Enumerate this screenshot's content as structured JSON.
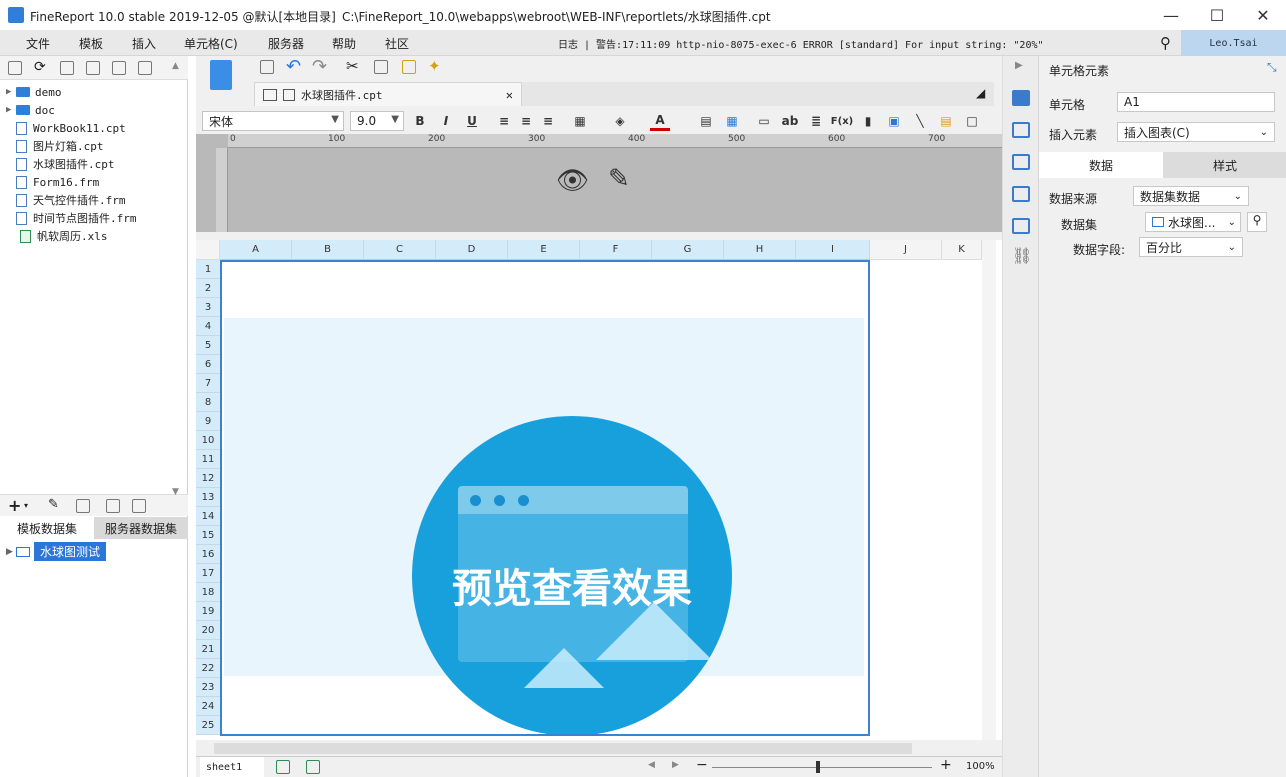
{
  "window": {
    "title": "FineReport 10.0 stable 2019-12-05 @默认[本地目录]",
    "path": "C:\\FineReport_10.0\\webapps\\webroot\\WEB-INF\\reportlets/水球图插件.cpt",
    "minimize": "—",
    "maximize": "☐",
    "close": "✕"
  },
  "menu": {
    "items": [
      "文件",
      "模板",
      "插入",
      "单元格(C)",
      "服务器",
      "帮助",
      "社区"
    ],
    "status": "日志 | 警告:17:11:09 http-nio-8075-exec-6 ERROR [standard] For input string: \"20%\"",
    "user": "Leo.Tsai"
  },
  "tree": {
    "items": [
      {
        "label": "demo",
        "type": "folder"
      },
      {
        "label": "doc",
        "type": "folder"
      },
      {
        "label": "WorkBook11.cpt",
        "type": "cpt"
      },
      {
        "label": "图片灯箱.cpt",
        "type": "cpt"
      },
      {
        "label": "水球图插件.cpt",
        "type": "cpt"
      },
      {
        "label": "Form16.frm",
        "type": "frm"
      },
      {
        "label": "天气控件插件.frm",
        "type": "frm"
      },
      {
        "label": "时间节点图插件.frm",
        "type": "frm"
      },
      {
        "label": "帆软周历.xls",
        "type": "xls"
      }
    ]
  },
  "datasets": {
    "tab_template": "模板数据集",
    "tab_server": "服务器数据集",
    "items": [
      "水球图测试"
    ]
  },
  "editor": {
    "file_tab": "水球图插件.cpt",
    "font": "宋体",
    "font_size": "9.0",
    "ruler_ticks": [
      "0",
      "100",
      "200",
      "300",
      "400",
      "500",
      "600",
      "700"
    ],
    "columns": [
      "A",
      "B",
      "C",
      "D",
      "E",
      "F",
      "G",
      "H",
      "I",
      "J",
      "K"
    ],
    "rows": [
      "1",
      "2",
      "3",
      "4",
      "5",
      "6",
      "7",
      "8",
      "9",
      "10",
      "11",
      "12",
      "13",
      "14",
      "15",
      "16",
      "17",
      "18",
      "19",
      "20",
      "21",
      "22",
      "23",
      "24",
      "25"
    ],
    "preview_text": "预览查看效果",
    "sheet": "sheet1",
    "zoom": "100%"
  },
  "props": {
    "header": "单元格元素",
    "cell_label": "单元格",
    "cell_value": "A1",
    "insert_label": "插入元素",
    "insert_value": "插入图表(C)",
    "tab_data": "数据",
    "tab_style": "样式",
    "source_label": "数据来源",
    "source_value": "数据集数据",
    "dataset_label": "数据集",
    "dataset_value": "水球图...",
    "field_label": "数据字段:",
    "field_value": "百分比"
  }
}
